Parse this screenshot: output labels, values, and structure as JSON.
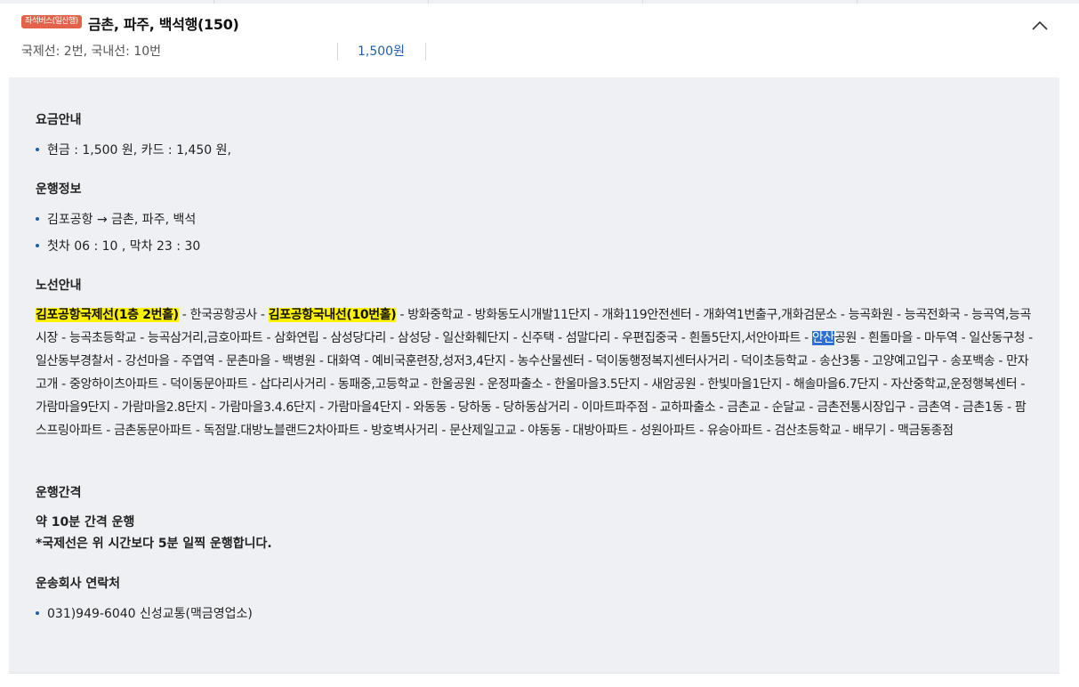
{
  "header": {
    "badge": "좌석버스(일산행)",
    "title": "금촌, 파주, 백석행(150)",
    "platform": "국제선: 2번, 국내선: 10번",
    "fare": "1,500원",
    "collapse_icon": "chevron-up-icon"
  },
  "fare_section": {
    "title": "요금안내",
    "items": [
      "현금 : 1,500 원, 카드 : 1,450 원,"
    ]
  },
  "operation_section": {
    "title": "운행정보",
    "items": [
      "김포공항 → 금촌, 파주, 백석",
      "첫차 06 : 10 , 막차 23 : 30"
    ]
  },
  "route_section": {
    "title": "노선안내",
    "stop1": "김포공항국제선(1층 2번홀)",
    "sep1": " - 한국공항공사 - ",
    "stop2": "김포공항국내선(10번홀)",
    "rest1": " - 방화중학교 - 방화동도시개발11단지 - 개화119안전센터 - 개화역1번출구,개화검문소 - 능곡화원 - 능곡전화국 - 능곡역,능곡시장 - 능곡초등학교 - 능곡삼거리,금호아파트 - 삼화연립 - 삼성당다리 - 삼성당 - 일산화훼단지 - 신주택 - 섬말다리 - 우편집중국 - 흰돌5단지,서안아파트 - ",
    "selected": "안산",
    "rest2": "공원 - 흰돌마을 - 마두역 - 일산동구청 - 일산동부경찰서 - 강선마을 - 주엽역 - 문촌마을 - 백병원 - 대화역 - 예비국훈련장,성저3,4단지 - 농수산물센터 - 덕이동행정복지센터사거리 - 덕이초등학교 - 송산3통 - 고양예고입구 - 송포백송 - 만자고개 - 중앙하이츠아파트 - 덕이동문아파트 - 삽다리사거리 - 동패중,고등학교 - 한울공원 - 운정파출소 - 한울마을3.5단지 - 새암공원 - 한빛마을1단지 - 해솔마을6.7단지 - 자산중학교,운정행복센터 - 가람마을9단지 - 가람마을2.8단지 - 가람마을3.4.6단지 - 가람마을4단지 - 와동동 - 당하동 - 당하동삼거리 - 이마트파주점 - 교하파출소 - 금촌교 - 순달교 - 금촌전통시장입구 - 금촌역 - 금촌1동 - 팜스프링아파트 - 금촌동문아파트 - 독점말.대방노블랜드2차아파트 - 방호벽사거리 - 문산제일고교 - 야동동 - 대방아파트 - 성원아파트 - 유승아파트 - 검산초등학교 - 배무기 - 맥금동종점"
  },
  "interval_section": {
    "title": "운행간격",
    "line1": "약 10분 간격 운행",
    "line2": "*국제선은 위 시간보다 5분 일찍 운행합니다."
  },
  "contact_section": {
    "title": "운송회사 연락처",
    "items": [
      "031)949-6040 신성교통(맥금영업소)"
    ]
  },
  "colors": {
    "accent": "#1f5fa8",
    "badge": "#e2624c",
    "highlight": "#fff200",
    "panel_bg": "#eef0f3"
  }
}
